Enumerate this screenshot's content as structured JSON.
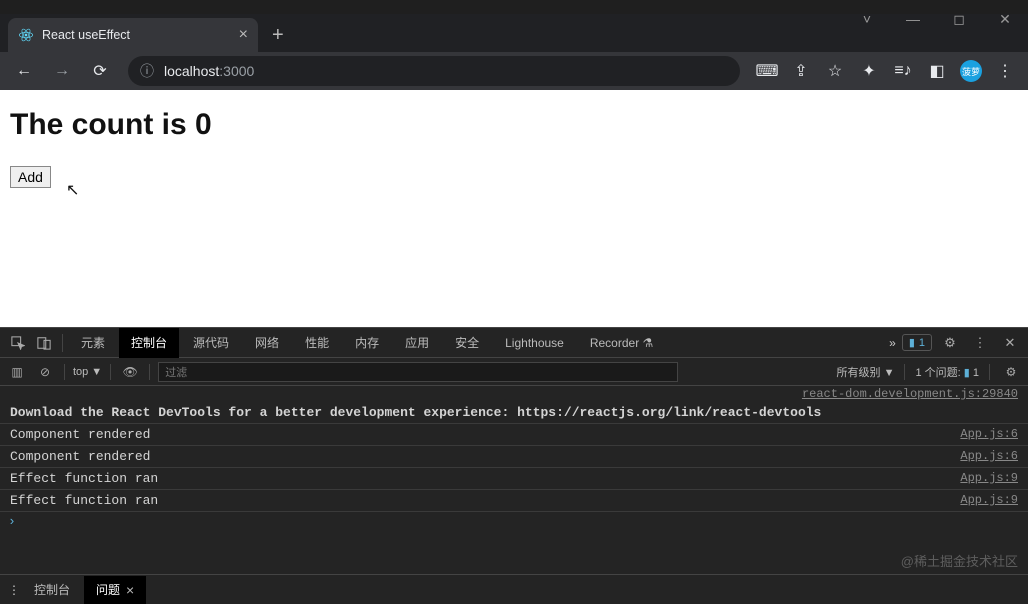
{
  "browser": {
    "tab": {
      "title": "React useEffect"
    },
    "url_info_icon": "ⓘ",
    "url_host": "localhost",
    "url_port": ":3000"
  },
  "page": {
    "heading": "The count is 0",
    "button_label": "Add"
  },
  "devtools": {
    "tabs": [
      "元素",
      "控制台",
      "源代码",
      "网络",
      "性能",
      "内存",
      "应用",
      "安全",
      "Lighthouse",
      "Recorder"
    ],
    "active_tab": "控制台",
    "more_indicator": "»",
    "issue_count": "1",
    "toolbar": {
      "context": "top",
      "filter_placeholder": "过滤",
      "levels": "所有级别",
      "issues_label": "1 个问题:"
    },
    "log_source_header": "react-dom.development.js:29840",
    "hint_prefix": "Download the React DevTools for a better development experience: ",
    "hint_link": "https://reactjs.org/link/react-devtools",
    "logs": [
      {
        "msg": "Component rendered",
        "src": "App.js:6"
      },
      {
        "msg": "Component rendered",
        "src": "App.js:6"
      },
      {
        "msg": "Effect function ran",
        "src": "App.js:9"
      },
      {
        "msg": "Effect function ran",
        "src": "App.js:9"
      }
    ],
    "drawer": {
      "tabs": [
        "控制台",
        "问题"
      ],
      "active": "问题"
    }
  },
  "watermark": "@稀土掘金技术社区"
}
